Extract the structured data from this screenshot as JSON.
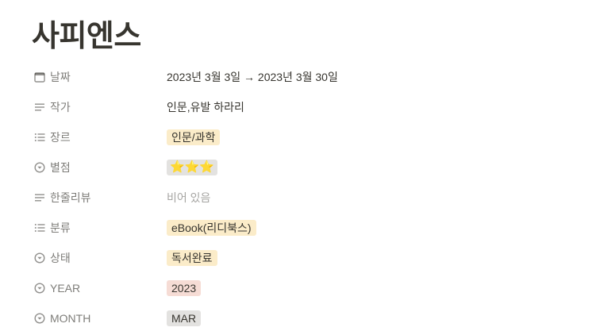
{
  "page": {
    "title": "사피엔스"
  },
  "properties": [
    {
      "name": "날짜",
      "icon": "calendar-icon",
      "type": "text",
      "value": "2023년 3월 3일 → 2023년 3월 30일"
    },
    {
      "name": "작가",
      "icon": "text-lines-icon",
      "type": "text",
      "value": "인문,유발 하라리"
    },
    {
      "name": "장르",
      "icon": "multi-select-icon",
      "type": "tag",
      "value": "인문/과학",
      "color": "#fbecc9"
    },
    {
      "name": "별점",
      "icon": "select-icon",
      "type": "tag",
      "value": "⭐⭐⭐",
      "color": "#e3e2e0"
    },
    {
      "name": "한줄리뷰",
      "icon": "text-lines-icon",
      "type": "empty",
      "value": "비어 있음"
    },
    {
      "name": "분류",
      "icon": "multi-select-icon",
      "type": "tag",
      "value": "eBook(리디북스)",
      "color": "#fbecc9"
    },
    {
      "name": "상태",
      "icon": "select-icon",
      "type": "tag",
      "value": "독서완료",
      "color": "#fbecc9"
    },
    {
      "name": "YEAR",
      "icon": "select-icon",
      "type": "tag",
      "value": "2023",
      "color": "#f6dcd5"
    },
    {
      "name": "MONTH",
      "icon": "select-icon",
      "type": "tag",
      "value": "MAR",
      "color": "#e3e2e0"
    }
  ]
}
